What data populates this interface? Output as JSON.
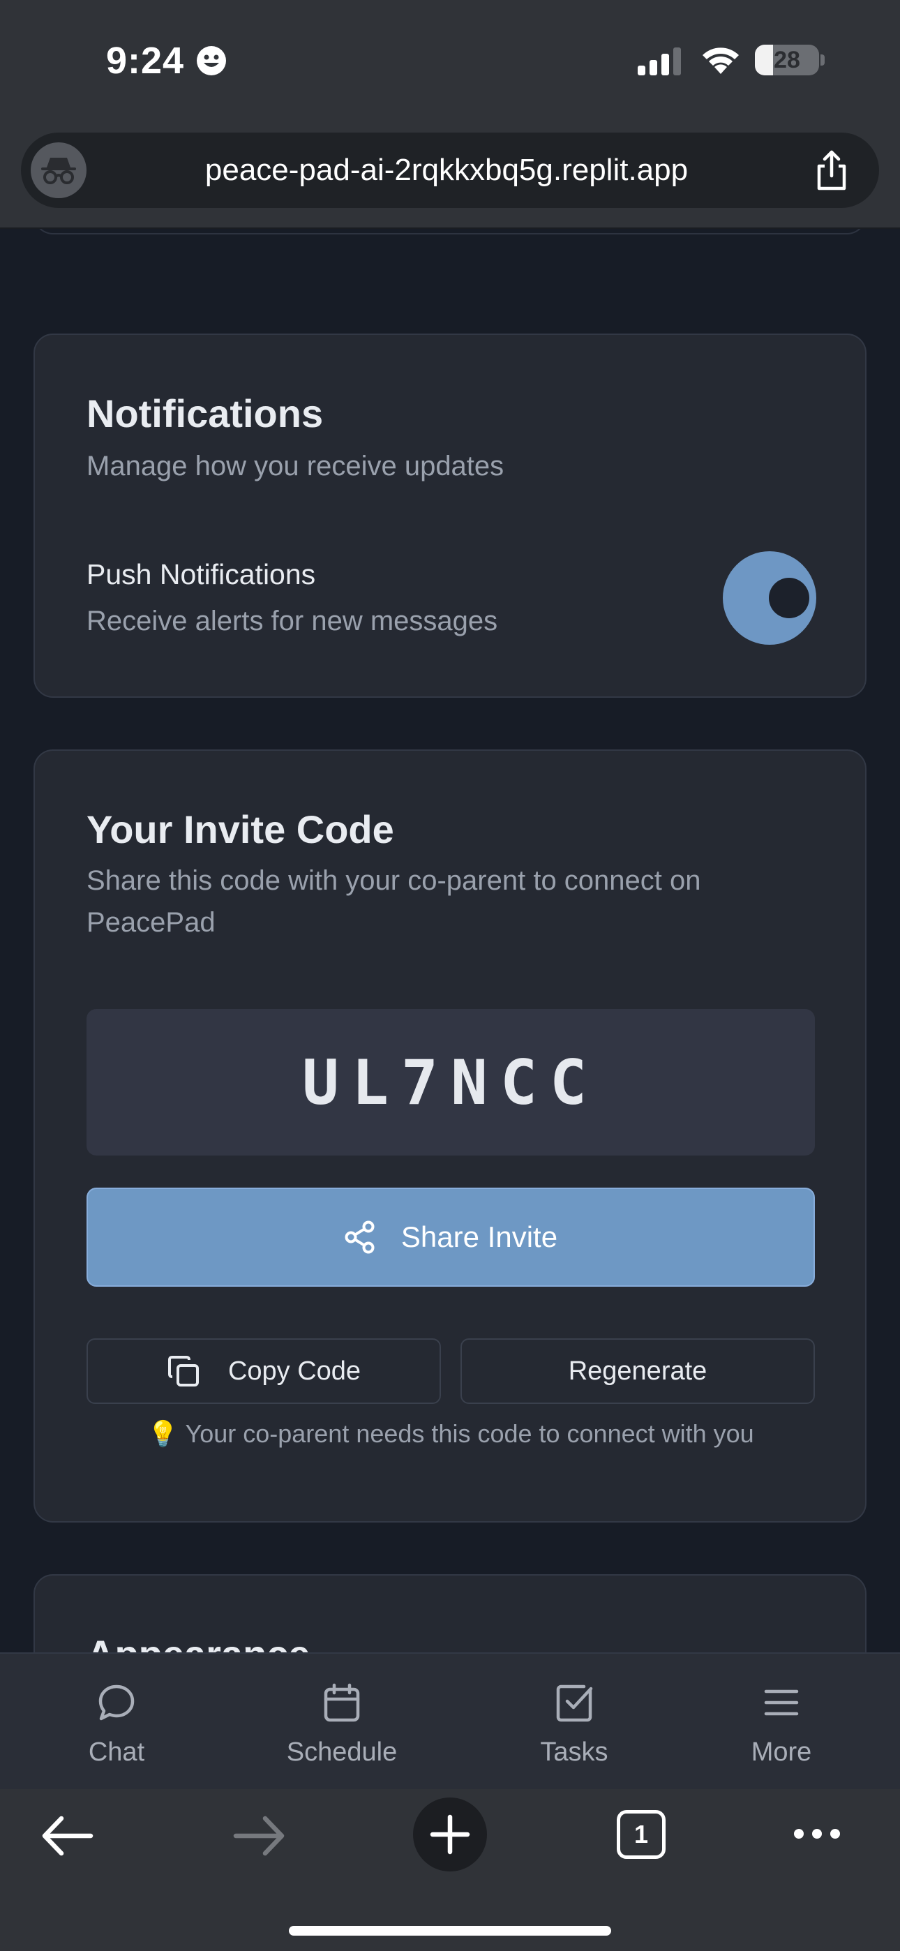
{
  "status_bar": {
    "time": "9:24",
    "battery": "28",
    "battery_level": 0.28
  },
  "browser": {
    "url": "peace-pad-ai-2rqkkxbq5g.replit.app",
    "tab_count": "1"
  },
  "notifications": {
    "title": "Notifications",
    "subtitle": "Manage how you receive updates",
    "push_label": "Push Notifications",
    "push_description": "Receive alerts for new messages",
    "push_enabled": true
  },
  "invite": {
    "title": "Your Invite Code",
    "subtitle": "Share this code with your co-parent to connect on PeacePad",
    "code": "UL7NCC",
    "share_label": "Share Invite",
    "copy_label": "Copy Code",
    "regenerate_label": "Regenerate",
    "hint": "Your co-parent needs this code to connect with you",
    "hint_icon": "💡"
  },
  "appearance": {
    "title": "Appearance"
  },
  "app_nav": [
    {
      "label": "Chat",
      "icon": "chat-bubble-icon"
    },
    {
      "label": "Schedule",
      "icon": "calendar-icon"
    },
    {
      "label": "Tasks",
      "icon": "checkbox-icon"
    },
    {
      "label": "More",
      "icon": "menu-icon"
    }
  ],
  "colors": {
    "accent": "#6e98c4",
    "background": "#171c26",
    "card": "#252932"
  }
}
